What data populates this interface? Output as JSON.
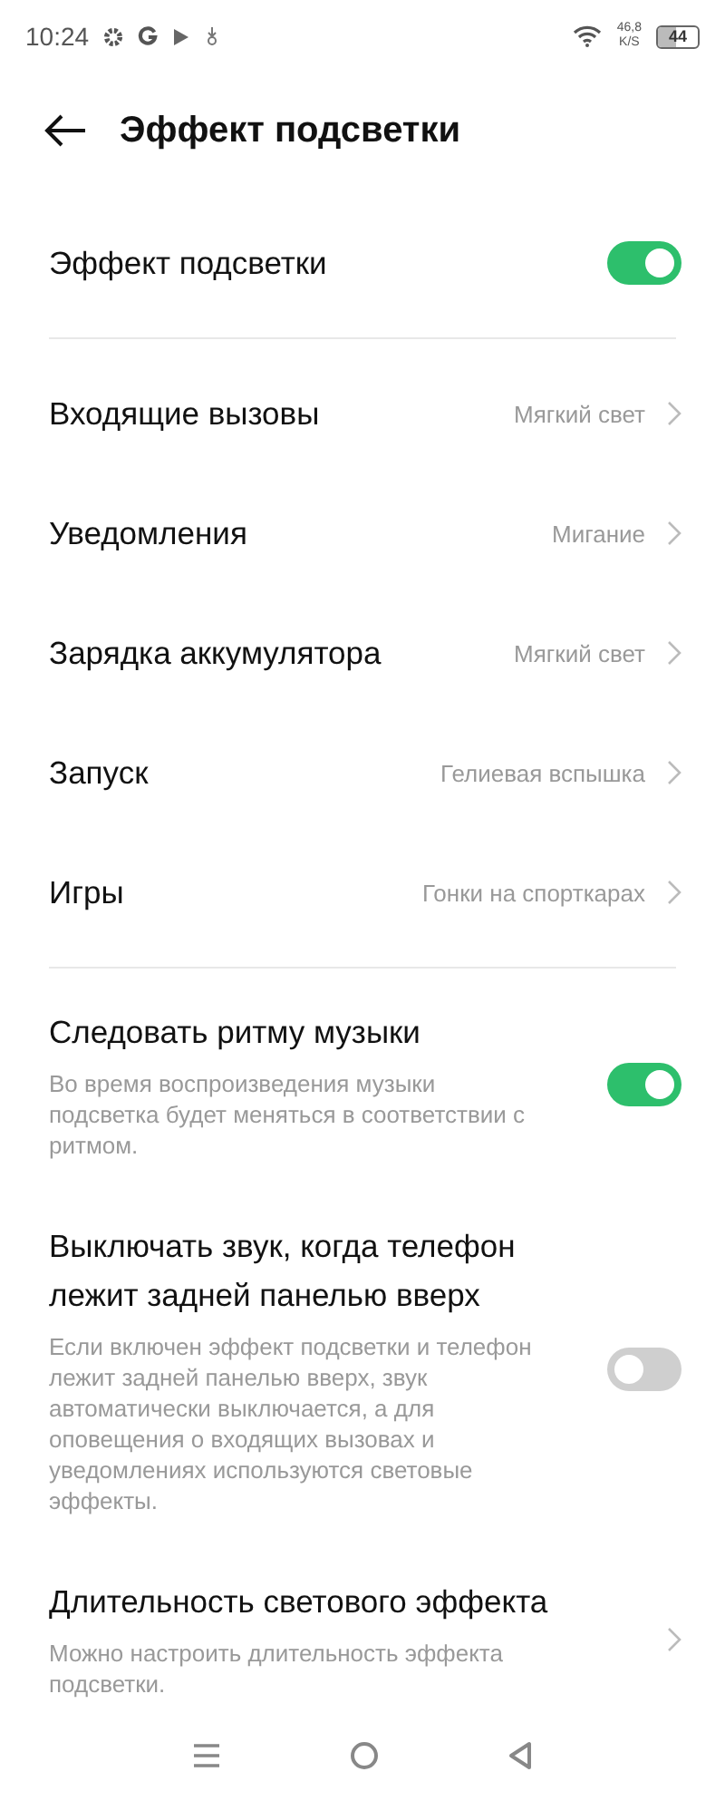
{
  "status_bar": {
    "time": "10:24",
    "speed_value": "46,8",
    "speed_unit": "K/S",
    "battery": "44"
  },
  "header": {
    "title": "Эффект подсветки"
  },
  "sections": [
    {
      "items": [
        {
          "kind": "switch",
          "title": "Эффект подсветки",
          "on": true
        }
      ]
    },
    {
      "items": [
        {
          "kind": "link",
          "title": "Входящие вызовы",
          "value": "Мягкий свет"
        },
        {
          "kind": "link",
          "title": "Уведомления",
          "value": "Мигание"
        },
        {
          "kind": "link",
          "title": "Зарядка аккумулятора",
          "value": "Мягкий свет"
        },
        {
          "kind": "link",
          "title": "Запуск",
          "value": "Гелиевая вспышка"
        },
        {
          "kind": "link",
          "title": "Игры",
          "value": "Гонки на спорткарах"
        }
      ]
    },
    {
      "items": [
        {
          "kind": "switch",
          "title": "Следовать ритму музыки",
          "description": "Во время воспроизведения музыки подсветка будет меняться в соответствии с ритмом.",
          "on": true
        },
        {
          "kind": "switch",
          "title": "Выключать звук, когда телефон лежит задней панелью вверх",
          "description": "Если включен эффект подсветки и телефон лежит задней панелью вверх, звук автоматически выключается, а для оповещения о входящих вызовах и уведомлениях используются световые эффекты.",
          "on": false
        },
        {
          "kind": "link",
          "title": "Длительность светового эффекта",
          "description": "Можно настроить длительность эффекта подсветки."
        }
      ]
    }
  ]
}
